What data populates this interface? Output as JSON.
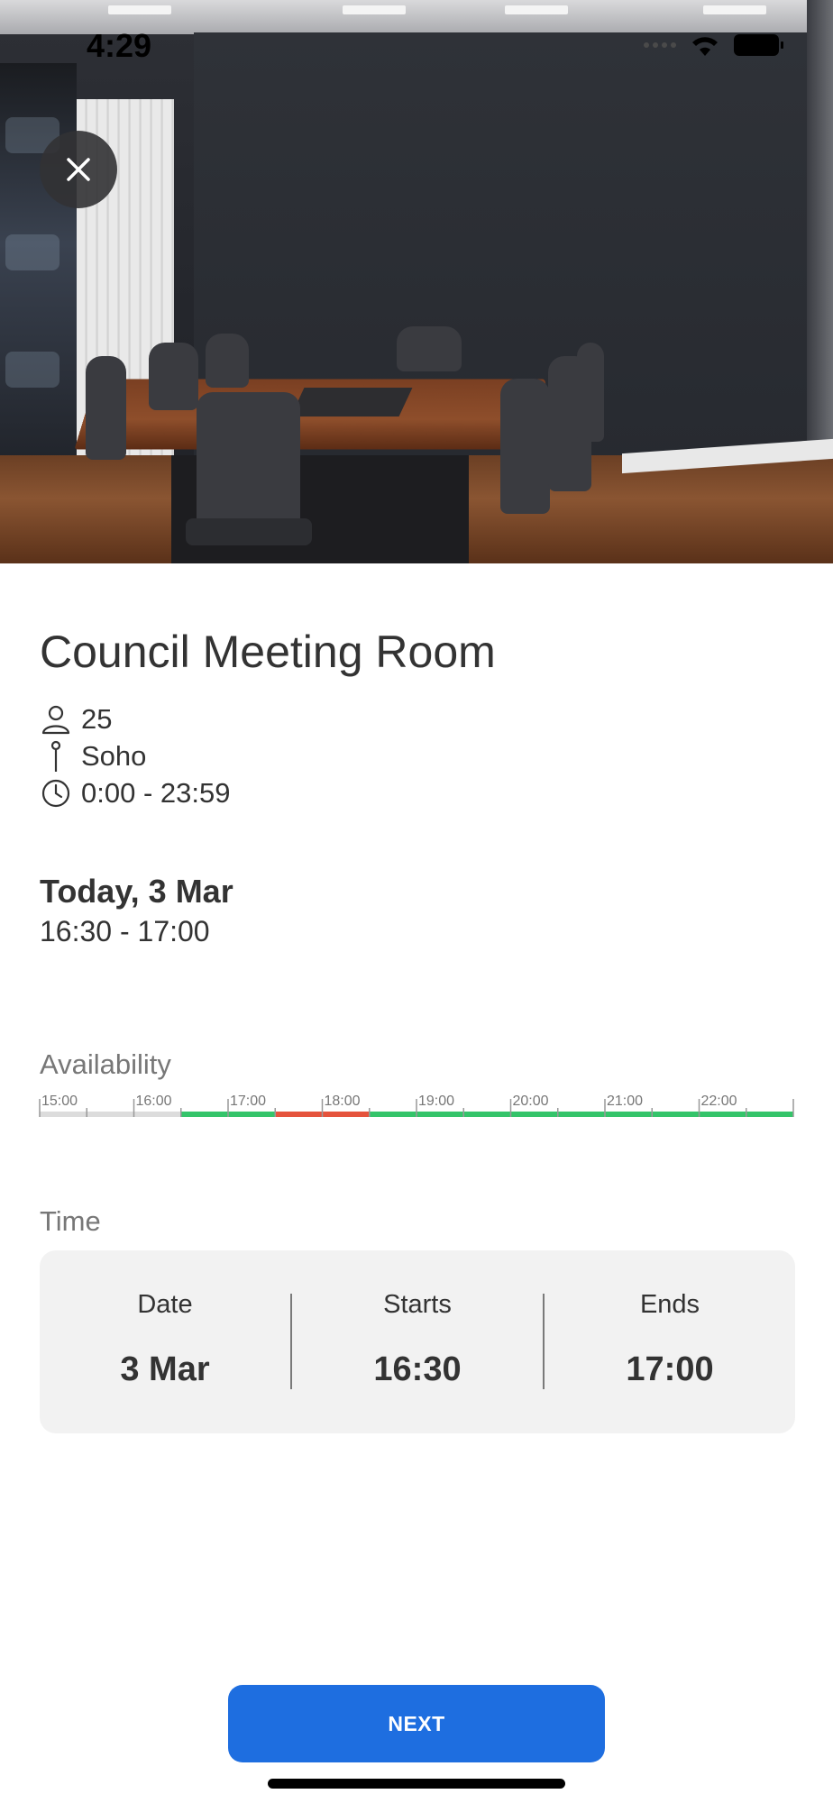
{
  "status_bar": {
    "time": "4:29"
  },
  "hero": {
    "image_alt": "conference room photo"
  },
  "room": {
    "title": "Council Meeting Room",
    "capacity": "25",
    "location": "Soho",
    "hours": "0:00 - 23:59"
  },
  "booking": {
    "date_heading": "Today, 3 Mar",
    "time_range": "16:30 - 17:00"
  },
  "availability": {
    "label": "Availability",
    "hours": [
      "15:00",
      "16:00",
      "17:00",
      "18:00",
      "19:00",
      "20:00",
      "21:00",
      "22:00"
    ],
    "segments": [
      "past",
      "past",
      "past",
      "available",
      "available",
      "busy",
      "busy",
      "available",
      "available",
      "available",
      "available",
      "available",
      "available",
      "available",
      "available",
      "available"
    ],
    "colors": {
      "past": "#dcdcdc",
      "available": "#34c46a",
      "busy": "#e5533c",
      "tick": "#999999"
    }
  },
  "time": {
    "label": "Time",
    "date_label": "Date",
    "date_value": "3 Mar",
    "starts_label": "Starts",
    "starts_value": "16:30",
    "ends_label": "Ends",
    "ends_value": "17:00"
  },
  "actions": {
    "next_label": "NEXT"
  },
  "colors": {
    "accent": "#1e6ee0"
  }
}
